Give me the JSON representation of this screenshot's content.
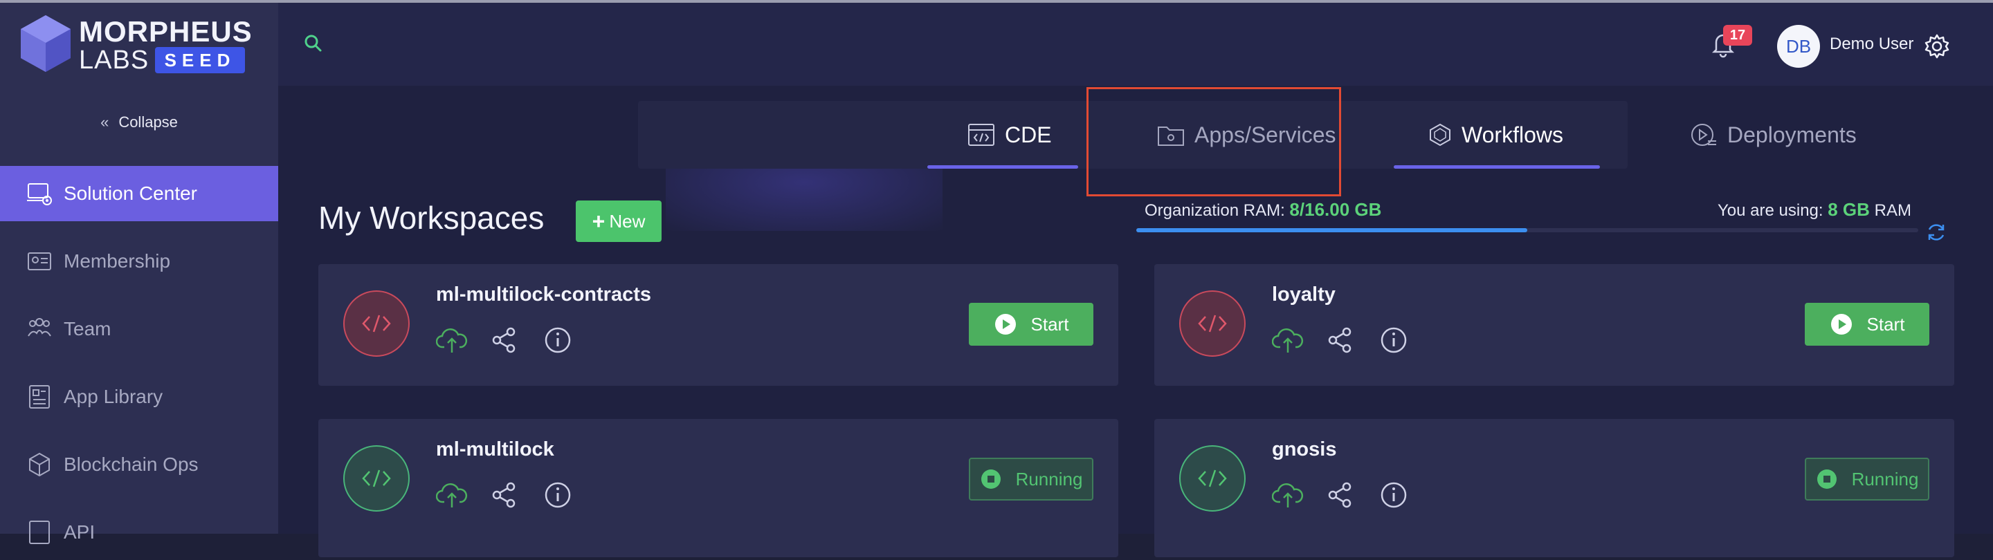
{
  "app": {
    "logo_line1": "MORPHEUS",
    "logo_line2": "LABS",
    "logo_badge": "SEED"
  },
  "sidebar": {
    "collapse_label": "Collapse",
    "items": [
      {
        "label": "Solution Center",
        "icon": "solution-center-icon",
        "active": true
      },
      {
        "label": "Membership",
        "icon": "membership-icon",
        "active": false
      },
      {
        "label": "Team",
        "icon": "team-icon",
        "active": false
      },
      {
        "label": "App Library",
        "icon": "app-library-icon",
        "active": false
      },
      {
        "label": "Blockchain Ops",
        "icon": "blockchain-ops-icon",
        "active": false
      },
      {
        "label": "API",
        "icon": "api-icon",
        "active": false
      }
    ]
  },
  "header": {
    "notification_count": "17",
    "user_initials": "DB",
    "user_name": "Demo User"
  },
  "tabs": [
    {
      "label": "CDE",
      "active": true
    },
    {
      "label": "Apps/Services",
      "active": false
    },
    {
      "label": "Workflows",
      "active": false
    },
    {
      "label": "Deployments",
      "active": false
    }
  ],
  "workspaces": {
    "title": "My Workspaces",
    "new_label": "New",
    "org_ram_label": "Organization RAM:",
    "org_ram_value": "8/16.00 GB",
    "org_ram_fraction": 0.5,
    "you_using_label": "You are using:",
    "you_using_value": "8 GB",
    "you_using_unit": "RAM",
    "cards": [
      {
        "name": "ml-multilock-contracts",
        "status": "stopped",
        "action_label": "Start"
      },
      {
        "name": "loyalty",
        "status": "stopped",
        "action_label": "Start"
      },
      {
        "name": "ml-multilock",
        "status": "running",
        "action_label": "Running"
      },
      {
        "name": "gnosis",
        "status": "running",
        "action_label": "Running"
      }
    ]
  },
  "colors": {
    "accent": "#6b5fe0",
    "success": "#4caf5e",
    "danger": "#e8455a",
    "highlight": "#e24a33"
  }
}
